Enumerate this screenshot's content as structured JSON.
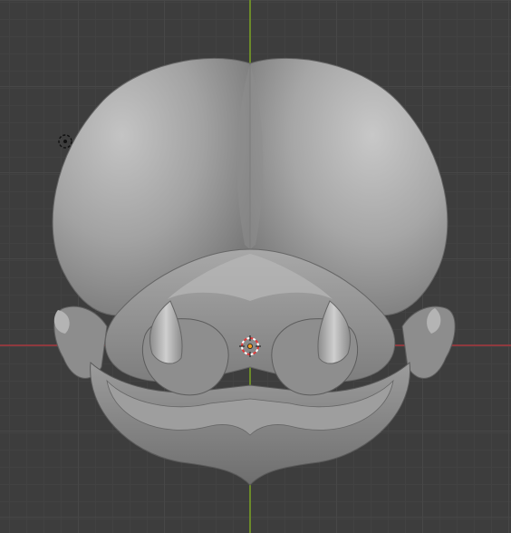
{
  "viewport": {
    "background_color": "#3d3d3d",
    "grid_color": "#474747",
    "x_axis_color": "#8f3a3e",
    "y_axis_color": "#6c8a2a"
  },
  "scene": {
    "object": "sculpted-head-mesh",
    "shading": "solid-gray",
    "view": "front-orthographic"
  },
  "icons": {
    "light": "point-light-icon",
    "cursor": "3d-cursor-icon",
    "origin": "object-origin-icon"
  },
  "colors": {
    "mesh_base": "#8c8c8c",
    "mesh_highlight": "#c2c2c2",
    "mesh_shadow": "#5e5e5e",
    "cursor_red": "#e03a3a",
    "origin_orange": "#f29b1f"
  }
}
